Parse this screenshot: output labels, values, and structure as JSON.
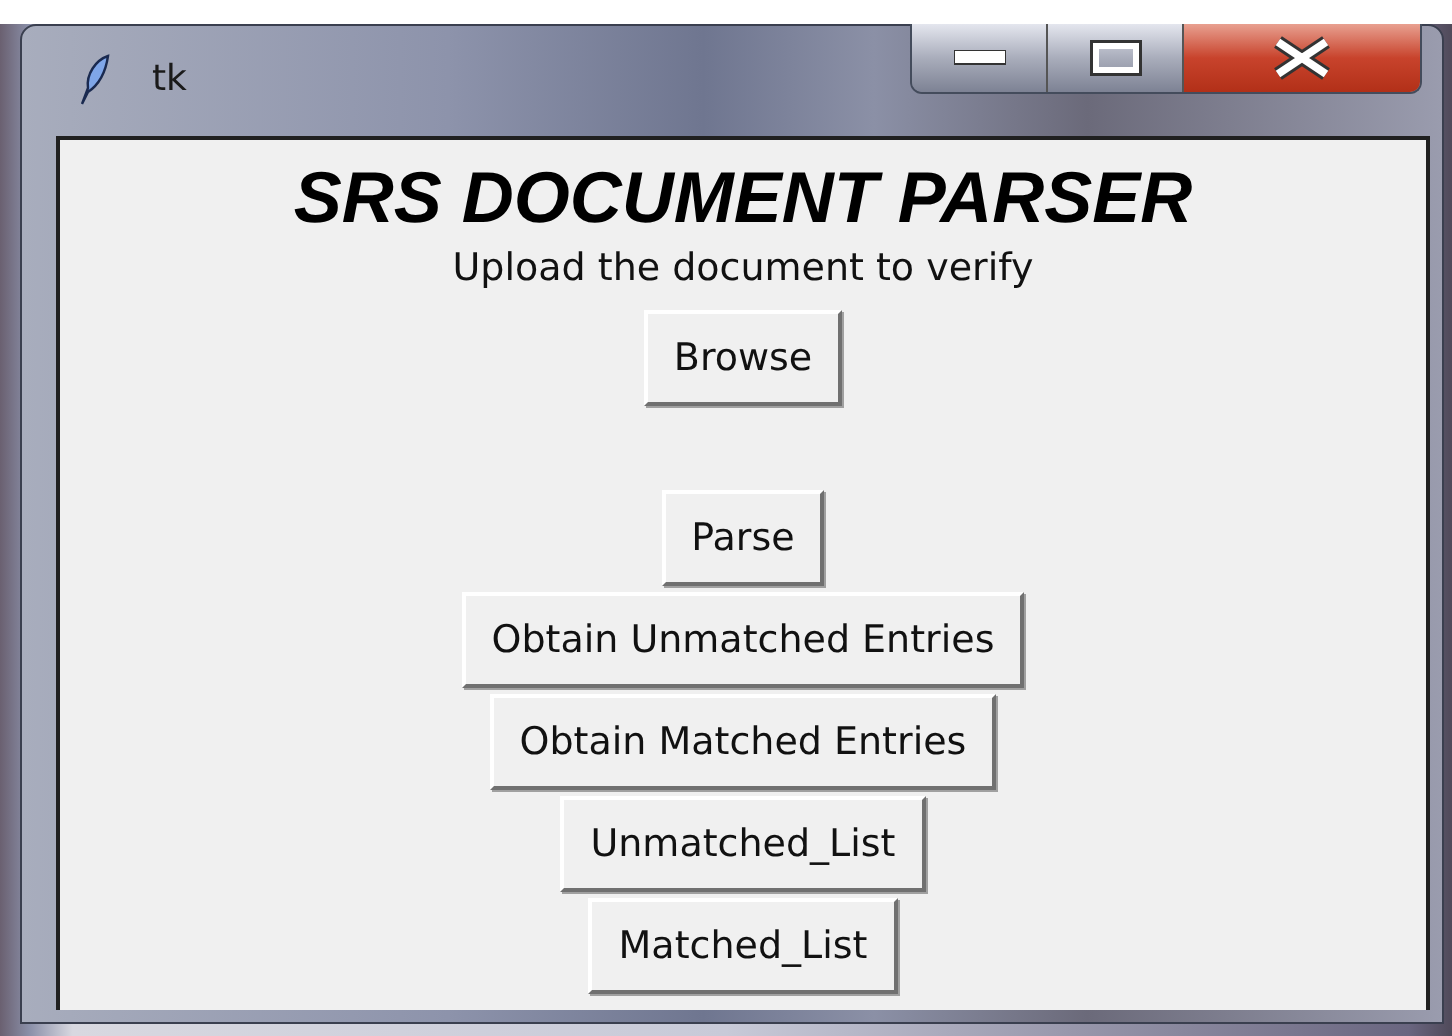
{
  "window": {
    "title": "tk"
  },
  "heading": "SRS DOCUMENT PARSER",
  "instruction": "Upload the document to verify",
  "buttons": [
    {
      "label": "Browse",
      "kind": "upload"
    },
    {
      "label": "Parse",
      "kind": "action"
    },
    {
      "label": "Obtain Unmatched Entries",
      "kind": "action"
    },
    {
      "label": "Obtain Matched Entries",
      "kind": "action"
    },
    {
      "label": "Unmatched_List",
      "kind": "action"
    },
    {
      "label": "Matched_List",
      "kind": "action"
    }
  ]
}
